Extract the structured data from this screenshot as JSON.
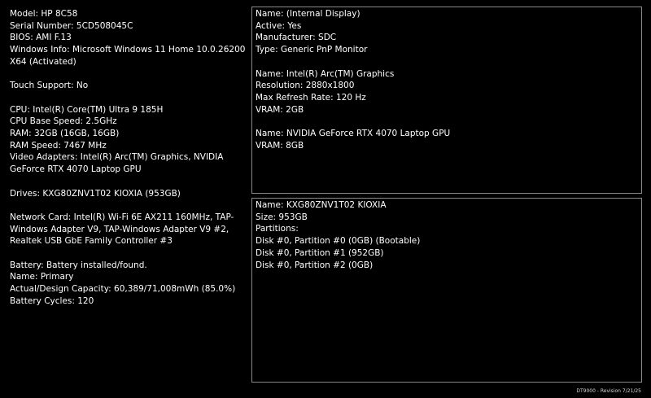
{
  "left": {
    "model": "Model: HP 8C58",
    "serial": "Serial Number: 5CD508045C",
    "bios": "BIOS: AMI F.13",
    "windows": "Windows Info: Microsoft Windows 11 Home 10.0.26200 X64 (Activated)",
    "touch": "Touch Support: No",
    "cpu": "CPU: Intel(R) Core(TM) Ultra 9 185H",
    "cpu_speed": "CPU Base Speed: 2.5GHz",
    "ram": "RAM: 32GB (16GB, 16GB)",
    "ram_speed": "RAM Speed: 7467 MHz",
    "video": "Video Adapters: Intel(R) Arc(TM) Graphics, NVIDIA GeForce RTX 4070 Laptop GPU",
    "drives": "Drives: KXG80ZNV1T02 KIOXIA (953GB)",
    "network": "Network Card: Intel(R) Wi-Fi 6E AX211 160MHz, TAP-Windows Adapter V9, TAP-Windows Adapter V9 #2, Realtek USB GbE Family Controller #3",
    "battery": "Battery: Battery installed/found.",
    "battery_name": "Name: Primary",
    "battery_capacity": "Actual/Design Capacity: 60,389/71,008mWh (85.0%)",
    "battery_cycles": "Battery Cycles: 120"
  },
  "display_panel": {
    "monitor_name": "Name: (Internal Display)",
    "monitor_active": "Active: Yes",
    "monitor_manufacturer": "Manufacturer: SDC",
    "monitor_type": "Type: Generic PnP Monitor",
    "gpu1_name": "Name: Intel(R) Arc(TM) Graphics",
    "gpu1_resolution": "Resolution: 2880x1800",
    "gpu1_refresh": "Max Refresh Rate: 120 Hz",
    "gpu1_vram": "VRAM: 2GB",
    "gpu2_name": "Name: NVIDIA GeForce RTX 4070 Laptop GPU",
    "gpu2_vram": "VRAM: 8GB"
  },
  "drive_panel": {
    "name": "Name: KXG80ZNV1T02 KIOXIA",
    "size": "Size: 953GB",
    "partitions_label": "Partitions:",
    "partition0": "Disk #0, Partition #0 (0GB) (Bootable)",
    "partition1": "Disk #0, Partition #1 (952GB)",
    "partition2": "Disk #0, Partition #2 (0GB)"
  },
  "footer": {
    "revision": "DT9000 - Revision 7/21/25"
  },
  "colors": {
    "background": "#000000",
    "text": "#ffffff",
    "border": "#8a8a8a"
  }
}
